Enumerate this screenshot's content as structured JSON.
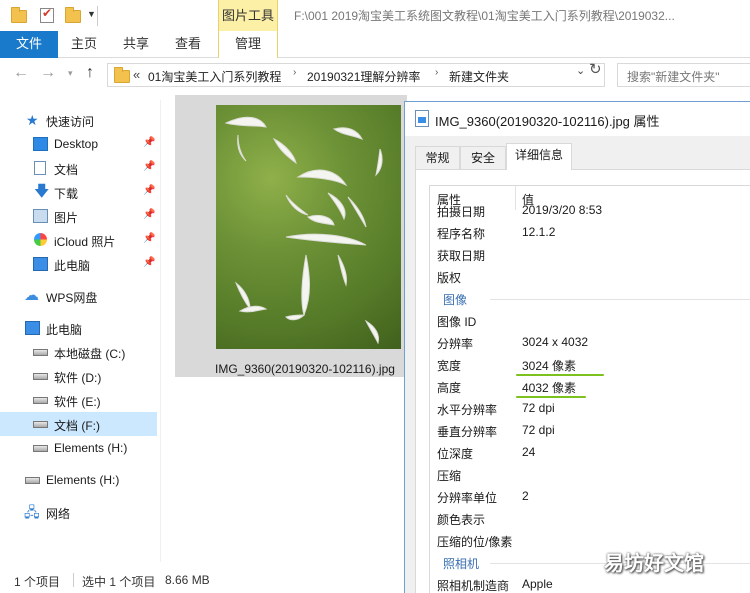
{
  "titlebar": {
    "contextual_tab": "图片工具",
    "path": "F:\\001 2019淘宝美工系统图文教程\\01淘宝美工入门系列教程\\2019032..."
  },
  "ribbon": {
    "tabs": [
      "文件",
      "主页",
      "共享",
      "查看",
      "管理"
    ]
  },
  "address": {
    "overflow": "«",
    "crumbs": [
      "01淘宝美工入门系列教程",
      "20190321理解分辨率",
      "新建文件夹"
    ],
    "search_placeholder": "搜索\"新建文件夹\""
  },
  "nav": {
    "items": [
      {
        "label": "快速访问",
        "icon": "star-icon"
      },
      {
        "label": "Desktop",
        "icon": "desktop-icon",
        "pinned": true
      },
      {
        "label": "文档",
        "icon": "documents-icon",
        "pinned": true
      },
      {
        "label": "下载",
        "icon": "download-icon",
        "pinned": true
      },
      {
        "label": "图片",
        "icon": "pictures-icon",
        "pinned": true
      },
      {
        "label": "iCloud 照片",
        "icon": "icloud-photos-icon",
        "pinned": true
      },
      {
        "label": "此电脑",
        "icon": "this-pc-icon",
        "pinned": true
      },
      {
        "label": "WPS网盘",
        "icon": "cloud-icon"
      },
      {
        "label": "此电脑",
        "icon": "this-pc-icon"
      },
      {
        "label": "本地磁盘 (C:)",
        "icon": "local-disk-icon"
      },
      {
        "label": "软件 (D:)",
        "icon": "drive-icon"
      },
      {
        "label": "软件 (E:)",
        "icon": "drive-icon"
      },
      {
        "label": "文档 (F:)",
        "icon": "drive-icon",
        "selected": true
      },
      {
        "label": "Elements (H:)",
        "icon": "drive-icon"
      },
      {
        "label": "Elements (H:)",
        "icon": "drive-icon"
      },
      {
        "label": "网络",
        "icon": "network-icon"
      }
    ]
  },
  "content": {
    "file_name": "IMG_9360(20190320-102116).jpg"
  },
  "status": {
    "count": "1 个项目",
    "selected": "选中 1 个项目",
    "size": "8.66 MB"
  },
  "dialog": {
    "title": "IMG_9360(20190320-102116).jpg 属性",
    "tabs": [
      "常规",
      "安全",
      "详细信息"
    ],
    "active_tab": "详细信息",
    "header": {
      "property": "属性",
      "value": "值"
    },
    "rows_top": [
      {
        "k": "拍摄日期",
        "v": "2019/3/20 8:53"
      },
      {
        "k": "程序名称",
        "v": "12.1.2"
      },
      {
        "k": "获取日期",
        "v": ""
      },
      {
        "k": "版权",
        "v": ""
      }
    ],
    "section_image": "图像",
    "rows_image": [
      {
        "k": "图像 ID",
        "v": ""
      },
      {
        "k": "分辨率",
        "v": "3024 x 4032"
      },
      {
        "k": "宽度",
        "v": "3024 像素"
      },
      {
        "k": "高度",
        "v": "4032 像素"
      },
      {
        "k": "水平分辨率",
        "v": "72 dpi"
      },
      {
        "k": "垂直分辨率",
        "v": "72 dpi"
      },
      {
        "k": "位深度",
        "v": "24"
      },
      {
        "k": "压缩",
        "v": ""
      },
      {
        "k": "分辨率单位",
        "v": "2"
      },
      {
        "k": "颜色表示",
        "v": ""
      },
      {
        "k": "压缩的位/像素",
        "v": ""
      }
    ],
    "section_camera": "照相机",
    "rows_camera": [
      {
        "k": "照相机制造商",
        "v": "Apple"
      }
    ]
  },
  "watermark": "易坊好文馆",
  "colors": {
    "file_tab": "#1979ca",
    "contextual_tab": "#fcefa6",
    "selected_nav": "#cce8ff",
    "highlight_mark": "#7cc11e",
    "section_label": "#3a6fb0"
  }
}
